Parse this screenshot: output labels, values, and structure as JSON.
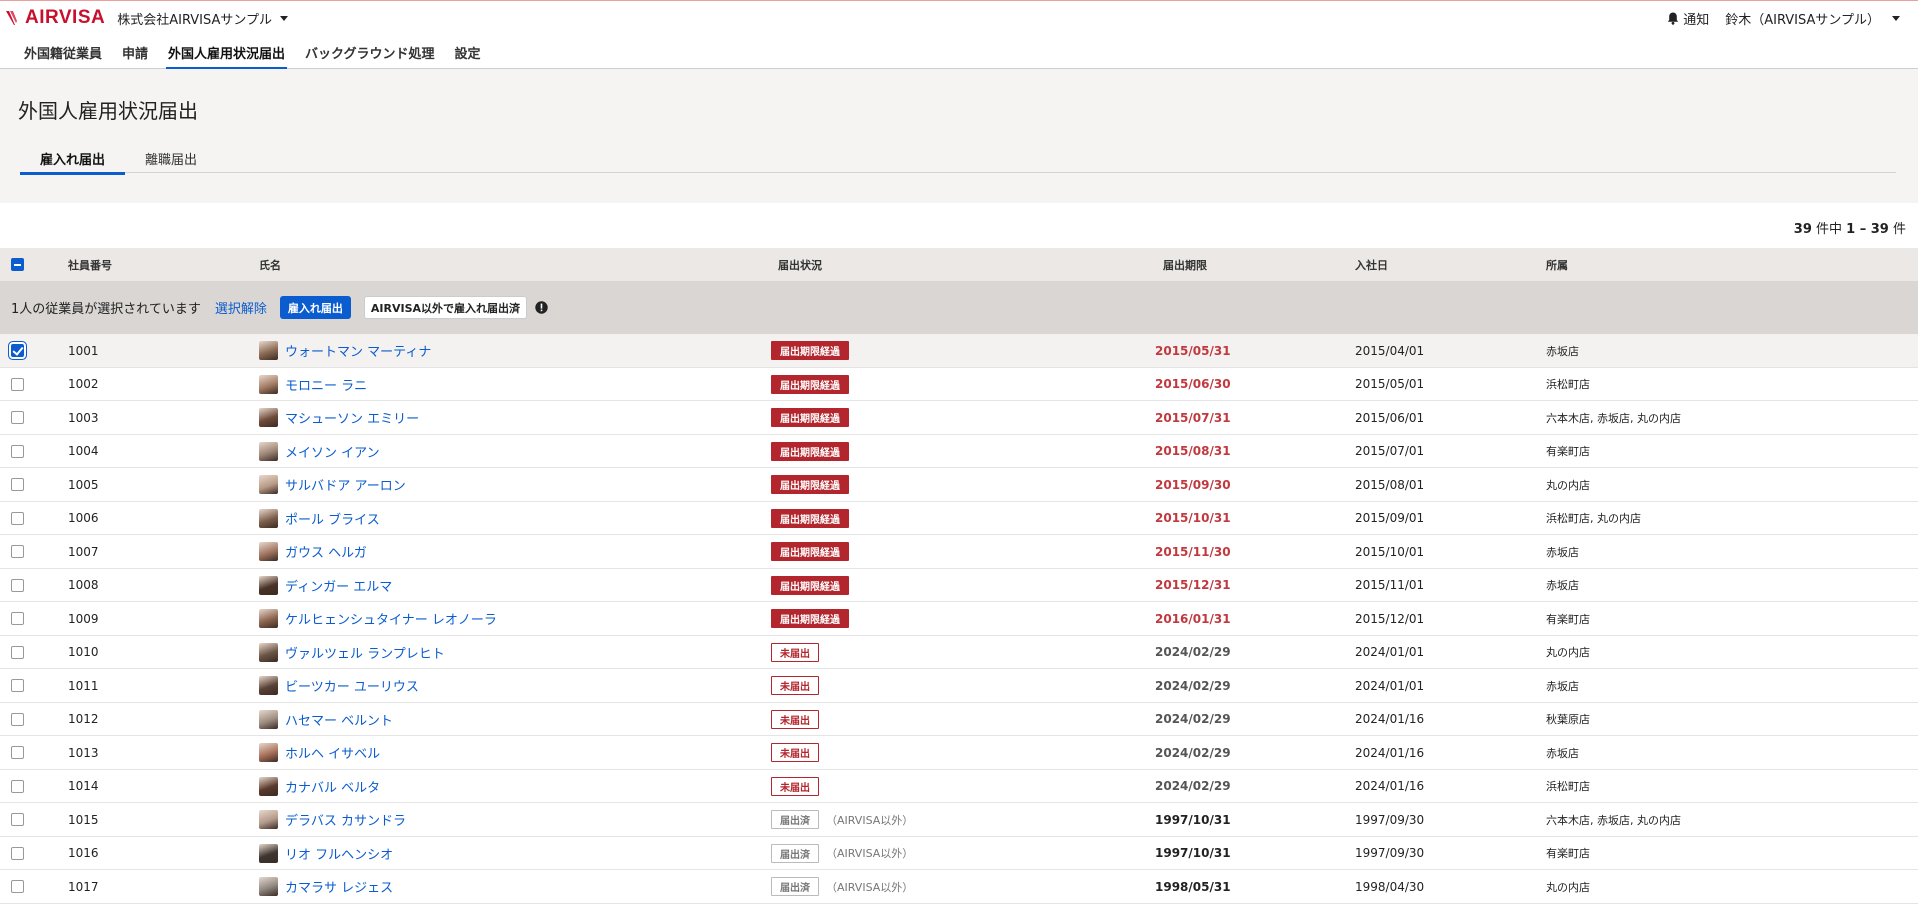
{
  "app": {
    "logo_text": "AIRVISA",
    "company": "株式会社AIRVISAサンプル",
    "notify_label": "通知",
    "user_label": "鈴木（AIRVISAサンプル）"
  },
  "nav": {
    "items": [
      {
        "label": "外国籍従業員",
        "active": false
      },
      {
        "label": "申請",
        "active": false
      },
      {
        "label": "外国人雇用状況届出",
        "active": true
      },
      {
        "label": "バックグラウンド処理",
        "active": false
      },
      {
        "label": "設定",
        "active": false
      }
    ]
  },
  "page": {
    "title": "外国人雇用状況届出",
    "tabs": [
      {
        "label": "雇入れ届出",
        "active": true
      },
      {
        "label": "離職届出",
        "active": false
      }
    ]
  },
  "pagination": {
    "total": "39",
    "total_suffix": " 件中 ",
    "range": "1 – 39",
    "range_suffix": " 件"
  },
  "table": {
    "columns": {
      "id": "社員番号",
      "name": "氏名",
      "status": "届出状況",
      "deadline": "届出期限",
      "join": "入社日",
      "dept": "所属"
    }
  },
  "selection": {
    "text": "1人の従業員が選択されています",
    "clear": "選択解除",
    "primary": "雇入れ届出",
    "secondary": "AIRVISA以外で雇入れ届出済"
  },
  "colors": {
    "accent": "#0a5ccf",
    "overdue": "#b3262d",
    "deadline_red": "#c0393f",
    "brand": "#c8102e"
  },
  "rows": [
    {
      "id": "1001",
      "name": "ウォートマン マーティナ",
      "status": "届出期限経過",
      "kind": "overdue",
      "note": "",
      "deadline": "2015/05/31",
      "dl": "red",
      "join": "2015/04/01",
      "dept": "赤坂店",
      "checked": true,
      "avatar": "#8a6a55"
    },
    {
      "id": "1002",
      "name": "モロニー ラニ",
      "status": "届出期限経過",
      "kind": "overdue",
      "note": "",
      "deadline": "2015/06/30",
      "dl": "red",
      "join": "2015/05/01",
      "dept": "浜松町店",
      "checked": false,
      "avatar": "#a37b63"
    },
    {
      "id": "1003",
      "name": "マシューソン エミリー",
      "status": "届出期限経過",
      "kind": "overdue",
      "note": "",
      "deadline": "2015/07/31",
      "dl": "red",
      "join": "2015/06/01",
      "dept": "六本木店, 赤坂店, 丸の内店",
      "checked": false,
      "avatar": "#6e4b3a"
    },
    {
      "id": "1004",
      "name": "メイソン イアン",
      "status": "届出期限経過",
      "kind": "overdue",
      "note": "",
      "deadline": "2015/08/31",
      "dl": "red",
      "join": "2015/07/01",
      "dept": "有楽町店",
      "checked": false,
      "avatar": "#9c8474"
    },
    {
      "id": "1005",
      "name": "サルバドア アーロン",
      "status": "届出期限経過",
      "kind": "overdue",
      "note": "",
      "deadline": "2015/09/30",
      "dl": "red",
      "join": "2015/08/01",
      "dept": "丸の内店",
      "checked": false,
      "avatar": "#b89a86"
    },
    {
      "id": "1006",
      "name": "ポール ブライス",
      "status": "届出期限経過",
      "kind": "overdue",
      "note": "",
      "deadline": "2015/10/31",
      "dl": "red",
      "join": "2015/09/01",
      "dept": "浜松町店, 丸の内店",
      "checked": false,
      "avatar": "#7d5f4d"
    },
    {
      "id": "1007",
      "name": "ガウス ヘルガ",
      "status": "届出期限経過",
      "kind": "overdue",
      "note": "",
      "deadline": "2015/11/30",
      "dl": "red",
      "join": "2015/10/01",
      "dept": "赤坂店",
      "checked": false,
      "avatar": "#a07460"
    },
    {
      "id": "1008",
      "name": "ディンガー エルマ",
      "status": "届出期限経過",
      "kind": "overdue",
      "note": "",
      "deadline": "2015/12/31",
      "dl": "red",
      "join": "2015/11/01",
      "dept": "赤坂店",
      "checked": false,
      "avatar": "#4a3328"
    },
    {
      "id": "1009",
      "name": "ケルヒェンシュタイナー レオノーラ",
      "status": "届出期限経過",
      "kind": "overdue",
      "note": "",
      "deadline": "2016/01/31",
      "dl": "red",
      "join": "2015/12/01",
      "dept": "有楽町店",
      "checked": false,
      "avatar": "#8c6450"
    },
    {
      "id": "1010",
      "name": "ヴァルツェル ランプレヒト",
      "status": "未届出",
      "kind": "pending",
      "note": "",
      "deadline": "2024/02/29",
      "dl": "gray",
      "join": "2024/01/01",
      "dept": "丸の内店",
      "checked": false,
      "avatar": "#6b5547"
    },
    {
      "id": "1011",
      "name": "ビーツカー ユーリウス",
      "status": "未届出",
      "kind": "pending",
      "note": "",
      "deadline": "2024/02/29",
      "dl": "gray",
      "join": "2024/01/01",
      "dept": "赤坂店",
      "checked": false,
      "avatar": "#5a4236"
    },
    {
      "id": "1012",
      "name": "ハセマー ベルント",
      "status": "未届出",
      "kind": "pending",
      "note": "",
      "deadline": "2024/02/29",
      "dl": "gray",
      "join": "2024/01/16",
      "dept": "秋葉原店",
      "checked": false,
      "avatar": "#9d8c80"
    },
    {
      "id": "1013",
      "name": "ホルヘ イサベル",
      "status": "未届出",
      "kind": "pending",
      "note": "",
      "deadline": "2024/02/29",
      "dl": "gray",
      "join": "2024/01/16",
      "dept": "赤坂店",
      "checked": false,
      "avatar": "#a8705a"
    },
    {
      "id": "1014",
      "name": "カナバル ベルタ",
      "status": "未届出",
      "kind": "pending",
      "note": "",
      "deadline": "2024/02/29",
      "dl": "gray",
      "join": "2024/01/16",
      "dept": "浜松町店",
      "checked": false,
      "avatar": "#5b3a2c"
    },
    {
      "id": "1015",
      "name": "デラバス カサンドラ",
      "status": "届出済",
      "kind": "done",
      "note": "（AIRVISA以外）",
      "deadline": "1997/10/31",
      "dl": "dark",
      "join": "1997/09/30",
      "dept": "六本木店, 赤坂店, 丸の内店",
      "checked": false,
      "avatar": "#b39a8b"
    },
    {
      "id": "1016",
      "name": "リオ フルヘンシオ",
      "status": "届出済",
      "kind": "done",
      "note": "（AIRVISA以外）",
      "deadline": "1997/10/31",
      "dl": "dark",
      "join": "1997/09/30",
      "dept": "有楽町店",
      "checked": false,
      "avatar": "#3e3531"
    },
    {
      "id": "1017",
      "name": "カマラサ レジェス",
      "status": "届出済",
      "kind": "done",
      "note": "（AIRVISA以外）",
      "deadline": "1998/05/31",
      "dl": "dark",
      "join": "1998/04/30",
      "dept": "丸の内店",
      "checked": false,
      "avatar": "#8e8680"
    }
  ]
}
